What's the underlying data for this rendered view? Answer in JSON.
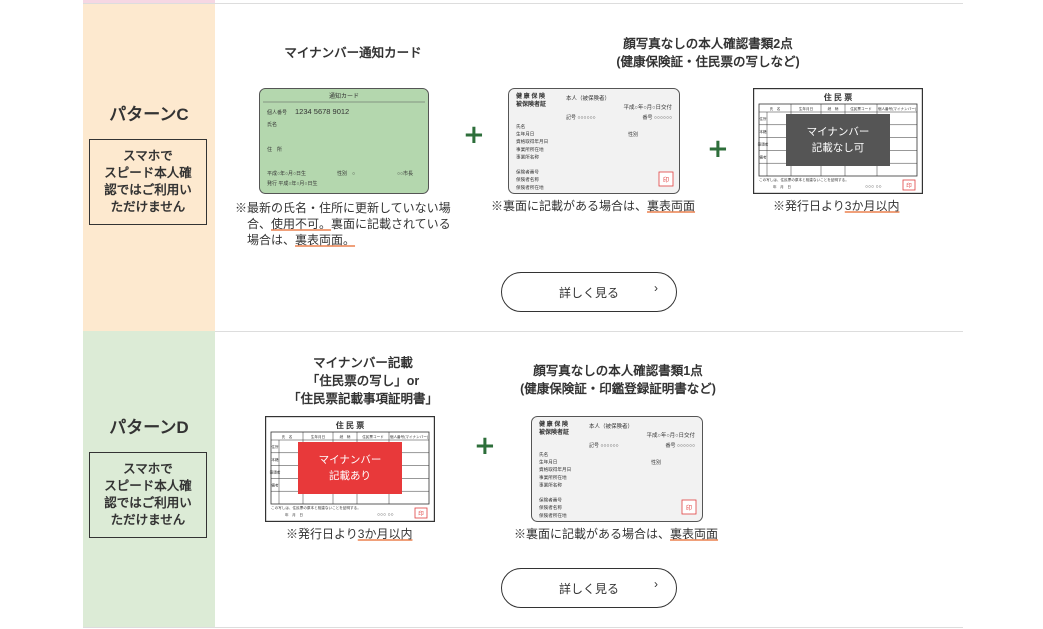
{
  "patterns": [
    {
      "title": "パターンC",
      "note_lines": [
        "スマホで",
        "スピード本人確",
        "認ではご利用い",
        "ただけません"
      ],
      "items": [
        {
          "label_lines": [
            "マイナンバー通知カード"
          ],
          "caption_parts": [
            "※最新の氏名・住所に更新していない場",
            "合、",
            "使用不可。",
            "裏面に記載されている",
            "場合は、",
            "裏表両面。"
          ],
          "card": {
            "header": "通知カード",
            "number_label": "個人番号",
            "number": "1234 5678 9012",
            "name_label": "氏名",
            "address_label": "住　所",
            "birth": "平成○年○月○日生",
            "gender": "性別　○",
            "office": "○○市長",
            "issued": "発行  平成○年○月○日生",
            "bg": "#b4d7ae"
          }
        },
        {
          "label_lines": [
            "顔写真なしの本人確認書類2点",
            "(健康保険証・住民票の写しなど)"
          ],
          "caption_parts": [
            "※裏面に記載がある場合は、",
            "裏表両面"
          ],
          "card": {
            "title_lines": [
              "健 康 保 険",
              "被保険者証"
            ],
            "person": "本人（被保険者）",
            "date": "平成○年○月○日交付",
            "code": "記号 ○○○○○○",
            "num": "番号 ○○○○○○",
            "fields": [
              "氏名",
              "生年月日",
              "資格取得年月日",
              "事業所所在地",
              "事業所名称",
              "",
              "保険者番号",
              "保険者名称",
              "保険者所在地"
            ],
            "gender": "性別",
            "seal": "印"
          }
        },
        {
          "label_lines": [],
          "caption_parts": [
            "※発行日より",
            "3か月以内"
          ],
          "card": {
            "title": "住 民 票",
            "headers": [
              "氏　名",
              "生年月日",
              "続　柄",
              "住民票コード",
              "個人番号(マイナンバー)"
            ],
            "side": [
              "住所",
              "本籍",
              "筆頭者",
              "備考"
            ],
            "overlay_lines": [
              "マイナンバー",
              "記載なし可"
            ],
            "overlay_color": "#555555",
            "footer": "この写しは、住民票の原本と相違ないことを証明する。",
            "date": "年　月　日",
            "office": "○○○  ○○",
            "seal": "印"
          }
        }
      ],
      "button": {
        "label": "詳しく見る",
        "chevron": "›"
      }
    },
    {
      "title": "パターンD",
      "note_lines": [
        "スマホで",
        "スピード本人確",
        "認ではご利用い",
        "ただけません"
      ],
      "items": [
        {
          "label_lines": [
            "マイナンバー記載",
            "「住民票の写し」or",
            "「住民票記載事項証明書」"
          ],
          "caption_parts": [
            "※発行日より",
            "3か月以内"
          ],
          "card": {
            "title": "住 民 票",
            "headers": [
              "氏　名",
              "生年月日",
              "続　柄",
              "住民票コード",
              "個人番号(マイナンバー)"
            ],
            "side": [
              "住所",
              "本籍",
              "筆頭者",
              "備考"
            ],
            "overlay_lines": [
              "マイナンバー",
              "記載あり"
            ],
            "overlay_color": "#e8393a",
            "footer": "この写しは、住民票の原本と相違ないことを証明する。",
            "date": "年　月　日",
            "office": "○○○  ○○",
            "seal": "印"
          }
        },
        {
          "label_lines": [
            "顔写真なしの本人確認書類1点",
            "(健康保険証・印鑑登録証明書など)"
          ],
          "caption_parts": [
            "※裏面に記載がある場合は、",
            "裏表両面"
          ],
          "card": {
            "title_lines": [
              "健 康 保 険",
              "被保険者証"
            ],
            "person": "本人（被保険者）",
            "date": "平成○年○月○日交付",
            "code": "記号 ○○○○○○",
            "num": "番号 ○○○○○○",
            "fields": [
              "氏名",
              "生年月日",
              "資格取得年月日",
              "事業所所在地",
              "事業所名称",
              "",
              "保険者番号",
              "保険者名称",
              "保険者所在地"
            ],
            "gender": "性別",
            "seal": "印"
          }
        }
      ],
      "button": {
        "label": "詳しく見る",
        "chevron": "›"
      }
    }
  ],
  "plus_sign": "+"
}
